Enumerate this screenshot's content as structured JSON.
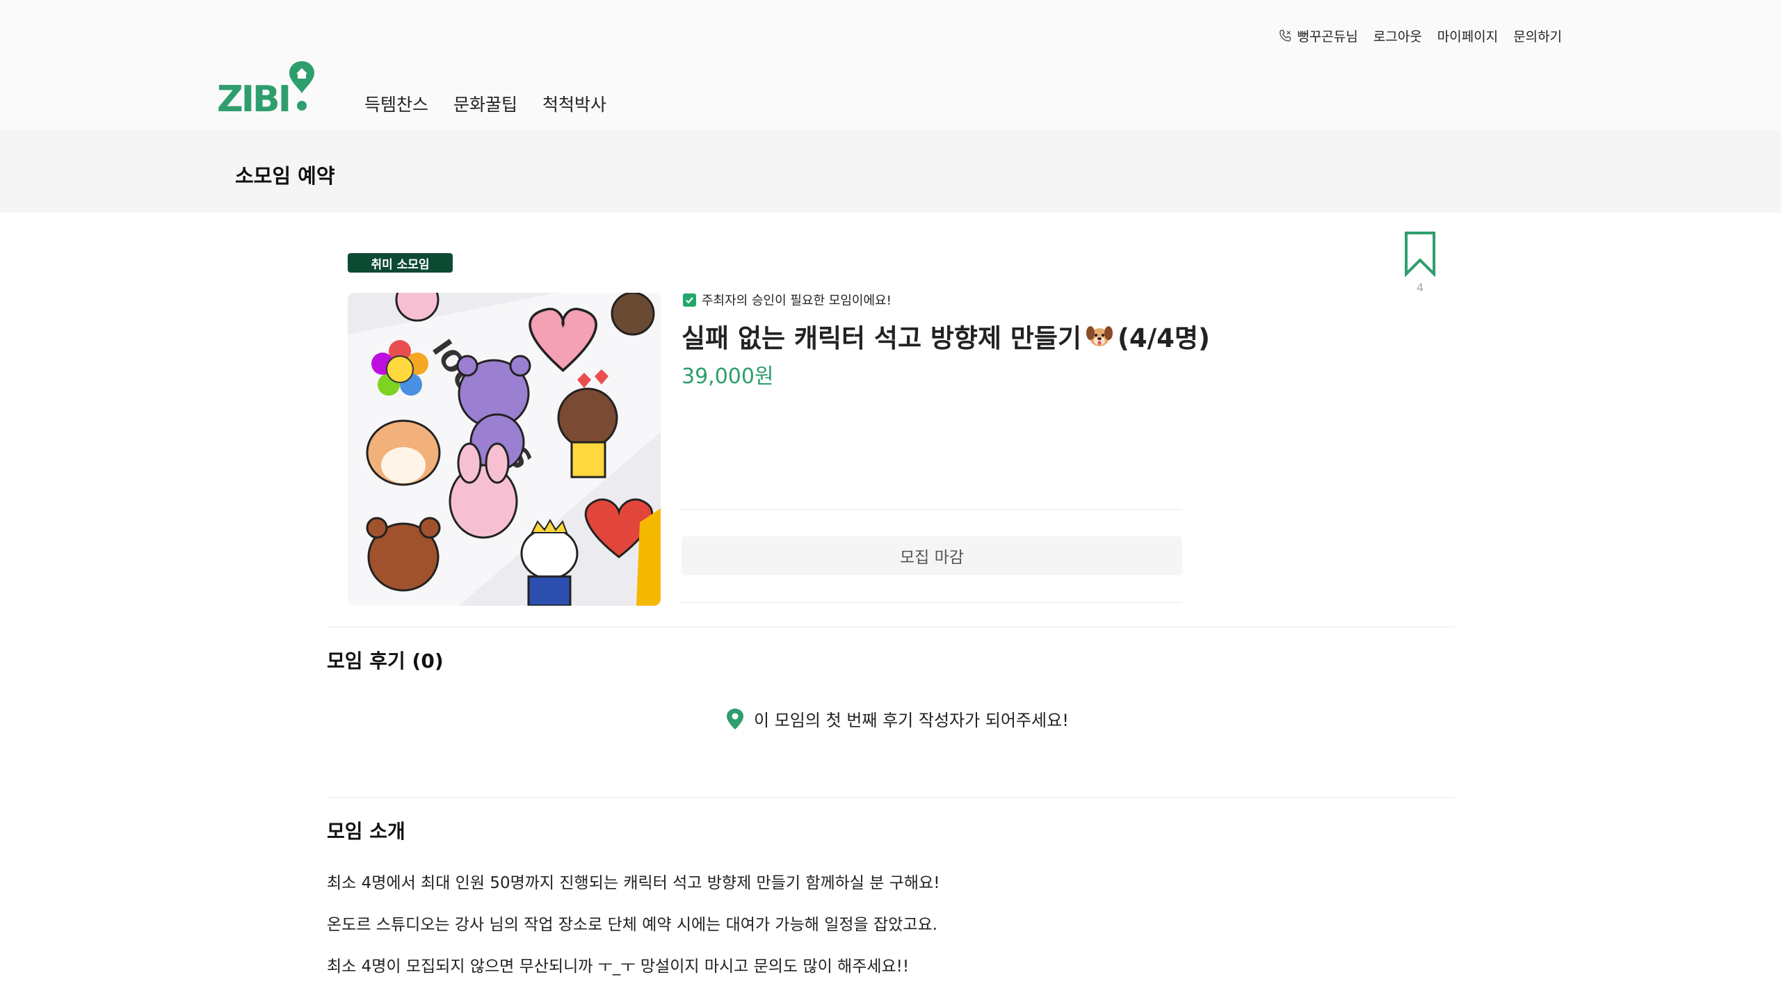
{
  "header": {
    "util_nav": {
      "user_name": "뻥꾸곤듀님",
      "logout": "로그아웃",
      "mypage": "마이페이지",
      "contact": "문의하기"
    },
    "logo_text": "ZIBI",
    "main_nav": [
      "득템찬스",
      "문화꿀팁",
      "척척박사"
    ]
  },
  "subheader": {
    "title": "소모임 예약"
  },
  "product": {
    "tag": "취미 소모임",
    "bookmark_count": "4",
    "approval_note": "주최자의 승인이 필요한 모임이에요!",
    "title": "실패 없는 캐릭터 석고 방향제 만들기",
    "capacity": "(4/4명)",
    "price": "39,000원",
    "status_button": "모집 마감"
  },
  "reviews": {
    "title": "모임 후기 (0)",
    "empty_message": "이 모임의 첫 번째 후기 작성자가 되어주세요!"
  },
  "intro": {
    "title": "모임 소개",
    "paragraphs": [
      "최소 4명에서 최대 인원 50명까지 진행되는 캐릭터 석고 방향제 만들기 함께하실 분 구해요!",
      "온도르 스튜디오는 강사 님의 작업 장소로 단체 예약 시에는 대여가 가능해 일정을 잡았고요.",
      "최소 4명이 모집되지 않으면 무산되니까 ㅜ_ㅜ 망설이지 마시고 문의도 많이 해주세요!!"
    ]
  },
  "colors": {
    "brand_green": "#2e9e6d",
    "tag_bg": "#0d4a33",
    "check_green": "#22a86a"
  },
  "icons": [
    "user-phone-icon",
    "location-pin-icon",
    "bookmark-icon",
    "check-icon",
    "dog-emoji-icon"
  ]
}
